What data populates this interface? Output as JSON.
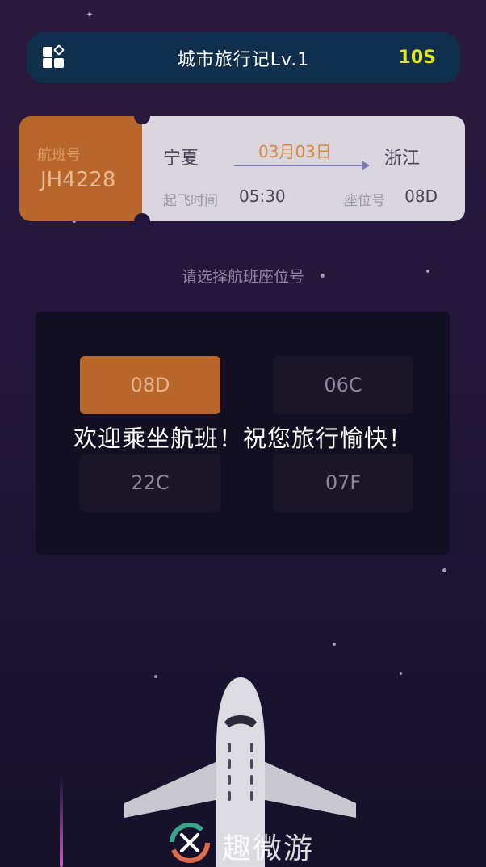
{
  "header": {
    "title": "城市旅行记Lv.1",
    "timer": "10S",
    "menu_icon": "apps-grid-icon",
    "timer_color": "#e3e81f"
  },
  "ticket": {
    "flight_label": "航班号",
    "flight_no": "JH4228",
    "from": "宁夏",
    "to": "浙江",
    "date": "03月03日",
    "departure_label": "起飞时间",
    "departure_time": "05:30",
    "seat_label": "座位号",
    "seat_no": "08D",
    "accent_color": "#b8662a"
  },
  "prompt": "请选择航班座位号",
  "seats": [
    {
      "label": "08D",
      "selected": true
    },
    {
      "label": "06C",
      "selected": false
    },
    {
      "label": "22C",
      "selected": false
    },
    {
      "label": "07F",
      "selected": false
    }
  ],
  "welcome": "欢迎乘坐航班！祝您旅行愉快！",
  "watermark": {
    "text": "趣微游",
    "logo_icon": "qu-logo-icon"
  }
}
